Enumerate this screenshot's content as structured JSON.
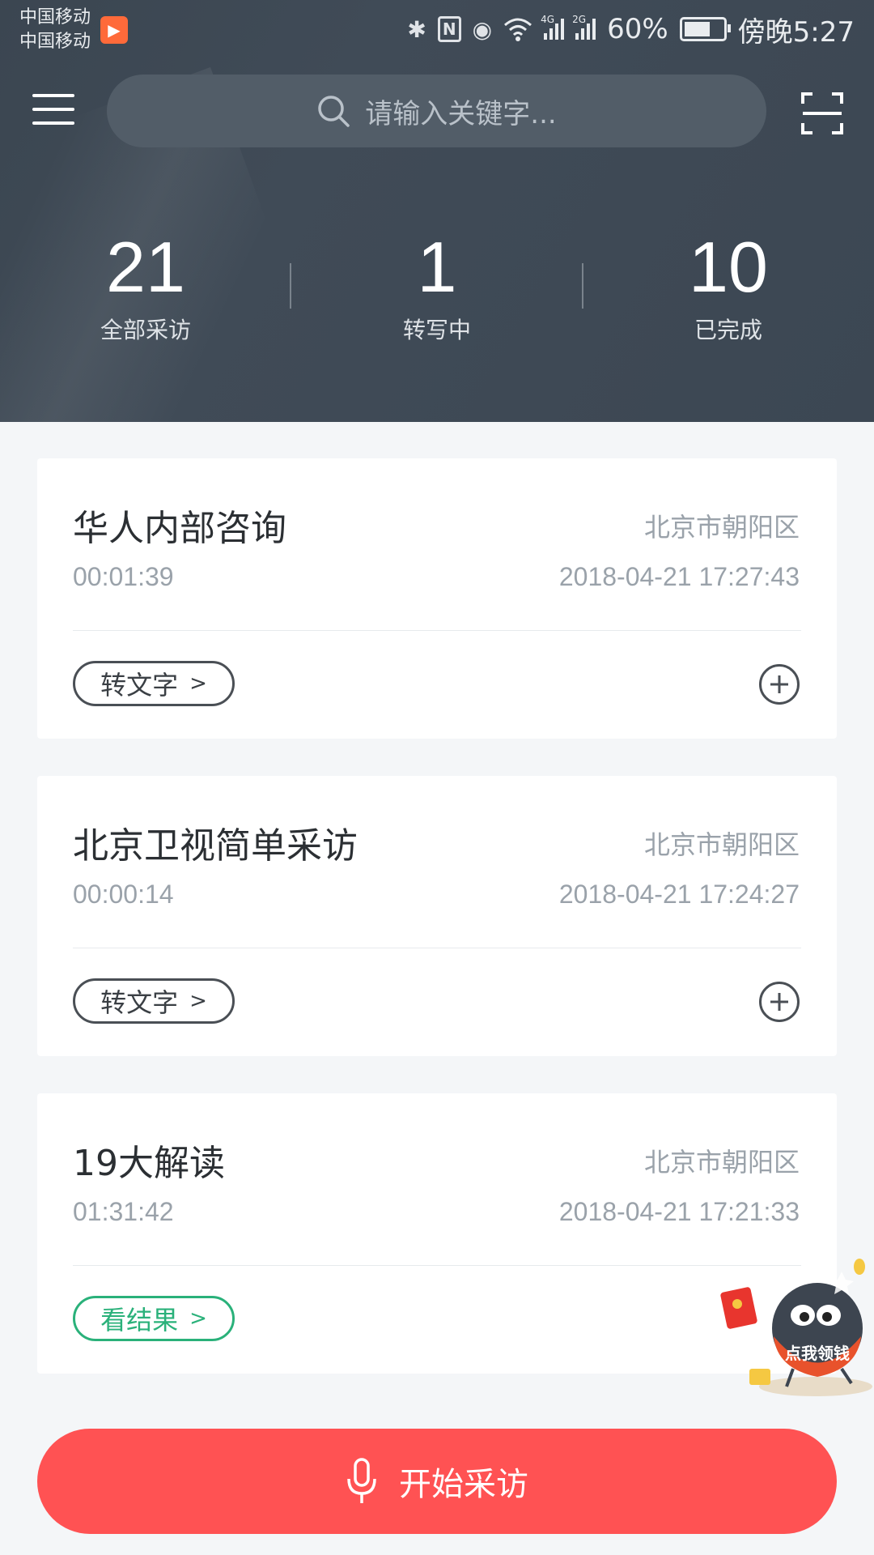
{
  "status_bar": {
    "carrier_1": "中国移动",
    "carrier_2": "中国移动",
    "net_4g": "4G",
    "net_2g": "2G",
    "battery": "60%",
    "time": "傍晚5:27"
  },
  "search": {
    "placeholder": "请输入关键字..."
  },
  "stats": [
    {
      "value": "21",
      "label": "全部采访"
    },
    {
      "value": "1",
      "label": "转写中"
    },
    {
      "value": "10",
      "label": "已完成"
    }
  ],
  "cards": [
    {
      "title": "华人内部咨询",
      "location": "北京市朝阳区",
      "duration": "00:01:39",
      "datetime": "2018-04-21 17:27:43",
      "action": "转文字"
    },
    {
      "title": "北京卫视简单采访",
      "location": "北京市朝阳区",
      "duration": "00:00:14",
      "datetime": "2018-04-21 17:24:27",
      "action": "转文字"
    },
    {
      "title": "19大解读",
      "location": "北京市朝阳区",
      "duration": "01:31:42",
      "datetime": "2018-04-21 17:21:33",
      "action": "看结果"
    }
  ],
  "mascot": {
    "text": "点我领钱"
  },
  "start_button": {
    "label": "开始采访"
  },
  "colors": {
    "header_bg": "#3e4954",
    "accent_red": "#ff5253",
    "result_green": "#2ab17a",
    "meta_gray": "#9aa2aa"
  },
  "icons": [
    "menu-icon",
    "search-icon",
    "scan-icon",
    "plus-icon",
    "chevron-right-icon",
    "microphone-icon",
    "bluetooth-icon",
    "nfc-icon",
    "eye-icon",
    "wifi-icon",
    "signal-icon",
    "battery-icon"
  ]
}
